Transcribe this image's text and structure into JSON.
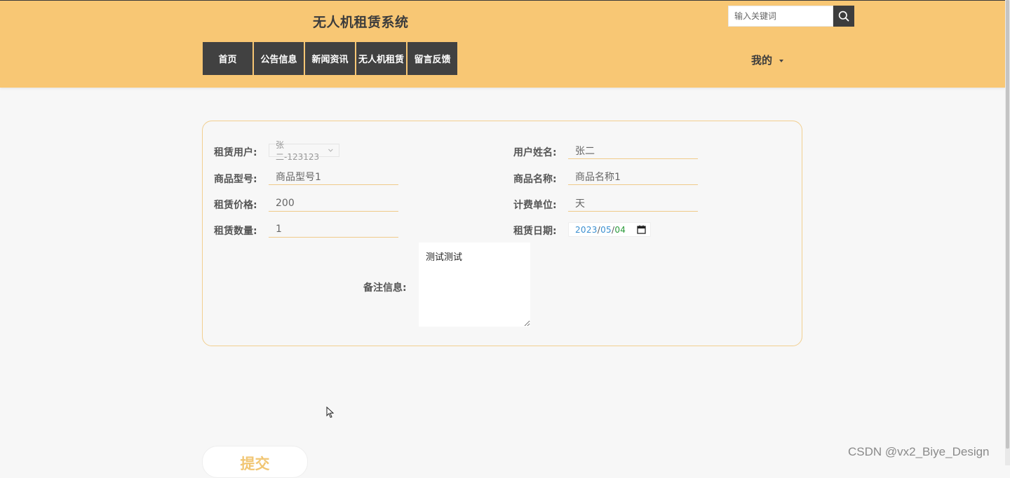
{
  "header": {
    "title": "无人机租赁系统",
    "search_placeholder": "输入关键词",
    "nav": [
      {
        "label": "首页"
      },
      {
        "label": "公告信息"
      },
      {
        "label": "新闻资讯"
      },
      {
        "label": "无人机租赁"
      },
      {
        "label": "留言反馈"
      }
    ],
    "user_menu": "我的"
  },
  "form": {
    "rent_user": {
      "label": "租赁用户:",
      "value": "张二-123123"
    },
    "user_name": {
      "label": "用户姓名:",
      "value": "张二"
    },
    "product_model": {
      "label": "商品型号:",
      "value": "商品型号1"
    },
    "product_name": {
      "label": "商品名称:",
      "value": "商品名称1"
    },
    "rent_price": {
      "label": "租赁价格:",
      "value": "200"
    },
    "billing_unit": {
      "label": "计费单位:",
      "value": "天"
    },
    "rent_quantity": {
      "label": "租赁数量:",
      "value": "1"
    },
    "rent_date": {
      "label": "租赁日期:",
      "year": "2023",
      "month": "05",
      "day": "04"
    },
    "remark": {
      "label": "备注信息:",
      "value": "测试测试"
    },
    "submit": "提交"
  },
  "watermark": "CSDN @vx2_Biye_Design",
  "colors": {
    "header_bg": "#f8c774",
    "nav_bg": "#414141",
    "accent": "#f1c673",
    "page_bg": "#f7f7f7"
  },
  "icons": [
    "search-icon",
    "chevron-down-icon",
    "calendar-icon",
    "cursor-icon"
  ]
}
